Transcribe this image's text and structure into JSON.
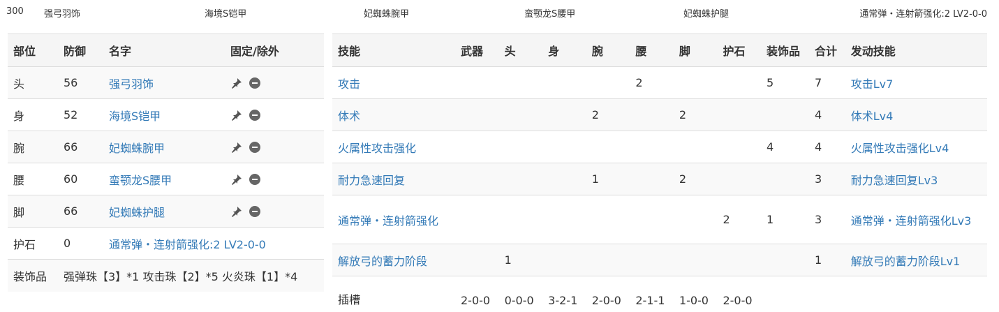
{
  "summary": {
    "defense": "300",
    "head": "强弓羽饰",
    "body": "海境S铠甲",
    "arm": "妃蜘蛛腕甲",
    "waist": "蛮颚龙S腰甲",
    "leg": "妃蜘蛛护腿",
    "charm": "通常弹・连射箭强化:2 LV2-0-0"
  },
  "equipment": {
    "headers": [
      "部位",
      "防御",
      "名字",
      "固定/除外"
    ],
    "rows": [
      {
        "part": "头",
        "defense": "56",
        "name": "强弓羽饰"
      },
      {
        "part": "身",
        "defense": "52",
        "name": "海境S铠甲"
      },
      {
        "part": "腕",
        "defense": "66",
        "name": "妃蜘蛛腕甲"
      },
      {
        "part": "腰",
        "defense": "60",
        "name": "蛮颚龙S腰甲"
      },
      {
        "part": "脚",
        "defense": "66",
        "name": "妃蜘蛛护腿"
      },
      {
        "part": "护石",
        "defense": "0",
        "name": "通常弹・连射箭强化:2 LV2-0-0"
      }
    ],
    "decorations_label": "装饰品",
    "decorations_value": "强弹珠【3】*1 攻击珠【2】*5 火炎珠【1】*4",
    "pin_icon": "pin-icon",
    "exclude_icon": "minus-circle-icon"
  },
  "skills": {
    "headers": [
      "技能",
      "武器",
      "头",
      "身",
      "腕",
      "腰",
      "脚",
      "护石",
      "装饰品",
      "合计",
      "发动技能"
    ],
    "rows": [
      {
        "name": "攻击",
        "weapon": "",
        "head": "",
        "body": "",
        "arm": "",
        "waist": "2",
        "leg": "",
        "charm": "",
        "deco": "5",
        "total": "7",
        "active": "攻击Lv7"
      },
      {
        "name": "体术",
        "weapon": "",
        "head": "",
        "body": "",
        "arm": "2",
        "waist": "",
        "leg": "2",
        "charm": "",
        "deco": "",
        "total": "4",
        "active": "体术Lv4"
      },
      {
        "name": "火属性攻击强化",
        "weapon": "",
        "head": "",
        "body": "",
        "arm": "",
        "waist": "",
        "leg": "",
        "charm": "",
        "deco": "4",
        "total": "4",
        "active": "火属性攻击强化Lv4"
      },
      {
        "name": "耐力急速回复",
        "weapon": "",
        "head": "",
        "body": "",
        "arm": "1",
        "waist": "",
        "leg": "2",
        "charm": "",
        "deco": "",
        "total": "3",
        "active": "耐力急速回复Lv3"
      },
      {
        "name": "通常弹・连射箭强化",
        "weapon": "",
        "head": "",
        "body": "",
        "arm": "",
        "waist": "",
        "leg": "",
        "charm": "2",
        "deco": "1",
        "total": "3",
        "active": "通常弹・连射箭强化Lv3"
      },
      {
        "name": "解放弓的蓄力阶段",
        "weapon": "",
        "head": "1",
        "body": "",
        "arm": "",
        "waist": "",
        "leg": "",
        "charm": "",
        "deco": "",
        "total": "1",
        "active": "解放弓的蓄力阶段Lv1"
      }
    ],
    "slots": {
      "label": "插槽",
      "weapon": "2-0-0",
      "head": "0-0-0",
      "body": "3-2-1",
      "arm": "2-0-0",
      "waist": "2-1-1",
      "leg": "1-0-0",
      "charm": "2-0-0"
    }
  }
}
